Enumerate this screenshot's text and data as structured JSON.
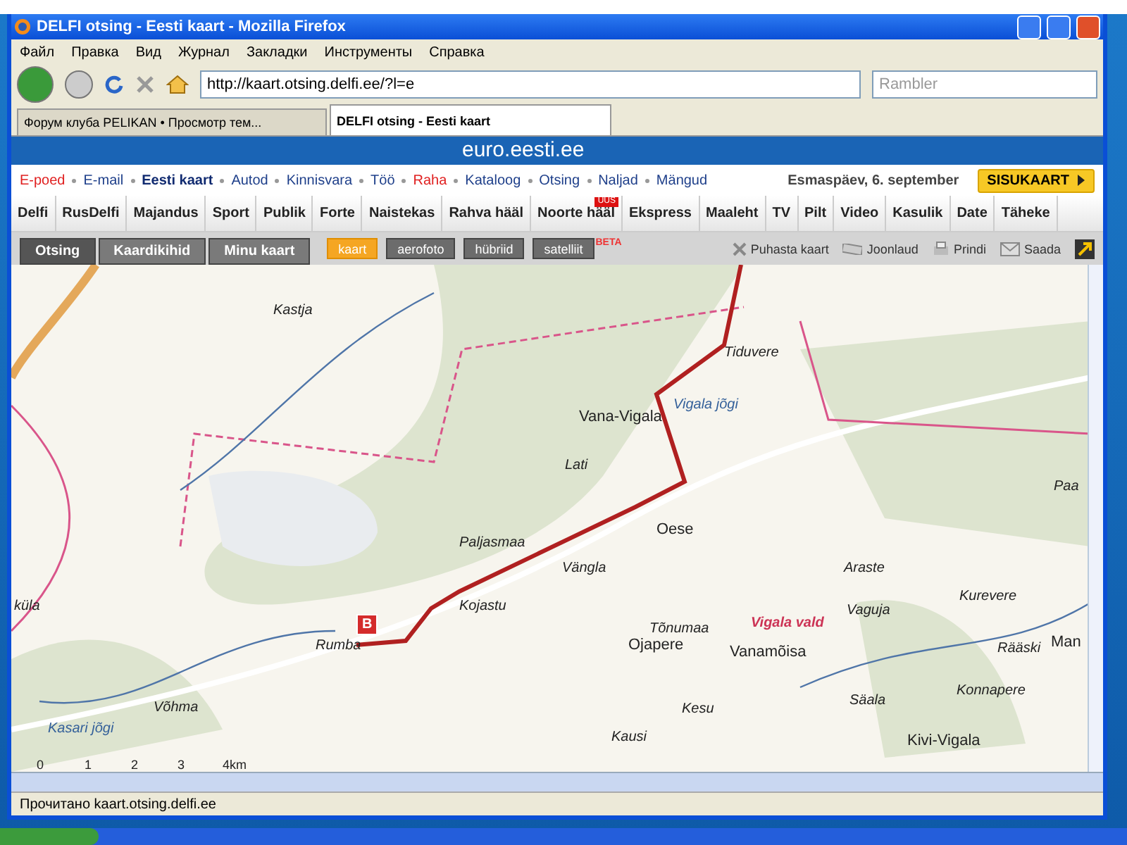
{
  "window": {
    "title": "DELFI otsing - Eesti kaart - Mozilla Firefox"
  },
  "menu": [
    "Файл",
    "Правка",
    "Вид",
    "Журнал",
    "Закладки",
    "Инструменты",
    "Справка"
  ],
  "address": {
    "value": "http://kaart.otsing.delfi.ee/?l=e"
  },
  "search": {
    "placeholder": "Rambler"
  },
  "tabs": [
    {
      "label": "Форум клуба PELIKAN • Просмотр тем...",
      "selected": false
    },
    {
      "label": "DELFI otsing - Eesti kaart",
      "selected": true
    }
  ],
  "banner": {
    "text": "euro.eesti.ee"
  },
  "portal_links": [
    {
      "label": "E-poed",
      "kind": "red"
    },
    {
      "label": "E-mail",
      "kind": "normal"
    },
    {
      "label": "Eesti kaart",
      "kind": "current"
    },
    {
      "label": "Autod",
      "kind": "normal"
    },
    {
      "label": "Kinnisvara",
      "kind": "normal"
    },
    {
      "label": "Töö",
      "kind": "normal"
    },
    {
      "label": "Raha",
      "kind": "red"
    },
    {
      "label": "Kataloog",
      "kind": "normal"
    },
    {
      "label": "Otsing",
      "kind": "normal"
    },
    {
      "label": "Naljad",
      "kind": "normal"
    },
    {
      "label": "Mängud",
      "kind": "normal"
    }
  ],
  "date": "Esmaspäev, 6. september",
  "sitemap_button": "SISUKAART",
  "sections": [
    {
      "label": "Delfi"
    },
    {
      "label": "RusDelfi"
    },
    {
      "label": "Majandus"
    },
    {
      "label": "Sport"
    },
    {
      "label": "Publik"
    },
    {
      "label": "Forte"
    },
    {
      "label": "Naistekas"
    },
    {
      "label": "Rahva hääl"
    },
    {
      "label": "Noorte hääl",
      "badge": "UUS"
    },
    {
      "label": "Ekspress"
    },
    {
      "label": "Maaleht"
    },
    {
      "label": "TV"
    },
    {
      "label": "Pilt"
    },
    {
      "label": "Video"
    },
    {
      "label": "Kasulik"
    },
    {
      "label": "Date"
    },
    {
      "label": "Täheke"
    }
  ],
  "map_tabs": [
    {
      "label": "Otsing",
      "selected": true
    },
    {
      "label": "Kaardikihid",
      "selected": false
    },
    {
      "label": "Minu kaart",
      "selected": false
    }
  ],
  "layers": [
    {
      "label": "kaart",
      "selected": true
    },
    {
      "label": "aerofoto",
      "selected": false
    },
    {
      "label": "hübriid",
      "selected": false
    },
    {
      "label": "satelliit",
      "selected": false,
      "badge": "BETA"
    }
  ],
  "tools": [
    {
      "label": "Puhasta kaart",
      "kind": "clear"
    },
    {
      "label": "Joonlaud",
      "kind": "ruler"
    },
    {
      "label": "Prindi",
      "kind": "print"
    },
    {
      "label": "Saada",
      "kind": "mail"
    }
  ],
  "map": {
    "places": [
      {
        "text": "Kastja",
        "kind": "village"
      },
      {
        "text": "Tiduvere",
        "kind": "village"
      },
      {
        "text": "Vana-Vigala",
        "kind": "town"
      },
      {
        "text": "Vigala jõgi",
        "kind": "river"
      },
      {
        "text": "Lati",
        "kind": "village"
      },
      {
        "text": "Paa",
        "kind": "village"
      },
      {
        "text": "Paljasmaa",
        "kind": "village"
      },
      {
        "text": "Oese",
        "kind": "town"
      },
      {
        "text": "Vängla",
        "kind": "village"
      },
      {
        "text": "Araste",
        "kind": "village"
      },
      {
        "text": "Kurevere",
        "kind": "village"
      },
      {
        "text": "küla",
        "kind": "village"
      },
      {
        "text": "Kojastu",
        "kind": "village"
      },
      {
        "text": "Vaguja",
        "kind": "village"
      },
      {
        "text": "Tõnumaa",
        "kind": "village"
      },
      {
        "text": "Vigala vald",
        "kind": "parish"
      },
      {
        "text": "Rumba",
        "kind": "village"
      },
      {
        "text": "Ojapere",
        "kind": "town"
      },
      {
        "text": "Vanamõisa",
        "kind": "town"
      },
      {
        "text": "Rääski",
        "kind": "village"
      },
      {
        "text": "Man",
        "kind": "town"
      },
      {
        "text": "Konnapere",
        "kind": "village"
      },
      {
        "text": "Võhma",
        "kind": "village"
      },
      {
        "text": "Kesu",
        "kind": "village"
      },
      {
        "text": "Säala",
        "kind": "village"
      },
      {
        "text": "Kasari jõgi",
        "kind": "river"
      },
      {
        "text": "Kausi",
        "kind": "village"
      },
      {
        "text": "Kivi-Vigala",
        "kind": "town"
      }
    ],
    "marker": "B",
    "scale": [
      "0",
      "1",
      "2",
      "3",
      "4km"
    ]
  },
  "status_bar": "Прочитано kaart.otsing.delfi.ee"
}
